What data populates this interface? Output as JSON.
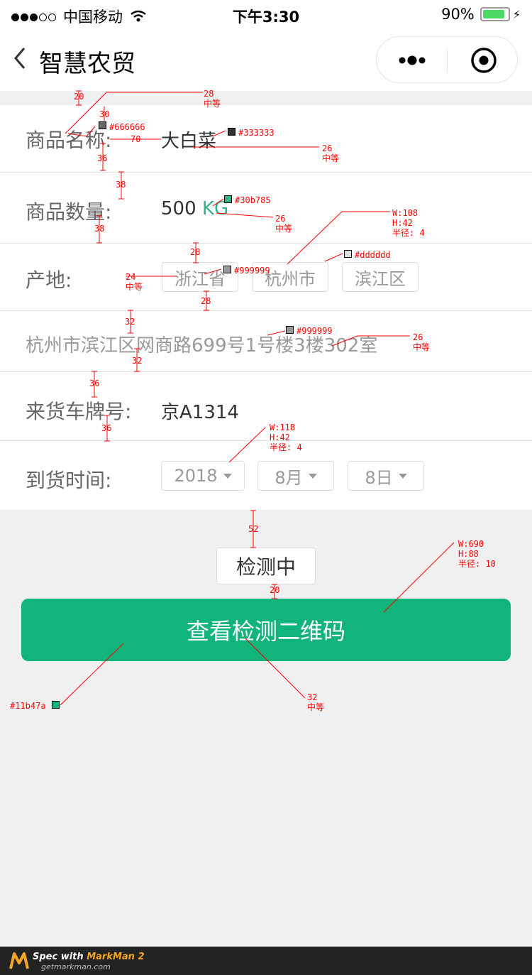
{
  "status_bar": {
    "carrier": "中国移动",
    "time": "下午3:30",
    "battery_percent": "90%",
    "battery_level": 0.9
  },
  "nav": {
    "title": "智慧农贸"
  },
  "form": {
    "product_name": {
      "label": "商品名称:",
      "value": "大白菜"
    },
    "quantity": {
      "label": "商品数量:",
      "value": "500",
      "unit": "KG"
    },
    "origin": {
      "label": "产地:",
      "province": "浙江省",
      "city": "杭州市",
      "district": "滨江区"
    },
    "address": "杭州市滨江区网商路699号1号楼3楼302室",
    "plate": {
      "label": "来货车牌号:",
      "value": "京A1314"
    },
    "arrival": {
      "label": "到货时间:",
      "year": "2018",
      "month": "8月",
      "day": "8日"
    }
  },
  "status_pill": "检测中",
  "qr_button": "查看检测二维码",
  "annotations": {
    "g20a": "20",
    "g30": "30",
    "g70": "70",
    "g36a": "36",
    "g38a": "38",
    "g38b": "38",
    "g28a": "28",
    "g28b": "28",
    "g32a": "32",
    "g32b": "32",
    "g36b": "36",
    "g36c": "36",
    "g52": "52",
    "g20b": "20",
    "label_font": "28\n中等",
    "value_font": "26\n中等",
    "unit_font": "26\n中等",
    "tag_font": "24\n中等",
    "address_font": "26\n中等",
    "button_font": "32\n中等",
    "tag_size": "W:108\nH:42\n半径: 4",
    "select_size": "W:118\nH:42\n半径: 4",
    "button_size": "W:690\nH:88\n半径: 10",
    "c666": "#666666",
    "c333": "#333333",
    "c30b": "#30b785",
    "cddd": "#dddddd",
    "c999a": "#999999",
    "c999b": "#999999",
    "c11b": "#11b47a"
  },
  "colors": {
    "label": "#666666",
    "value": "#333333",
    "unit": "#30b785",
    "border": "#dddddd",
    "muted": "#999999",
    "primary": "#11b47a"
  },
  "footer": {
    "title_prefix": "Spec with ",
    "brand": "MarkMan 2",
    "site": "getmarkman.com"
  }
}
